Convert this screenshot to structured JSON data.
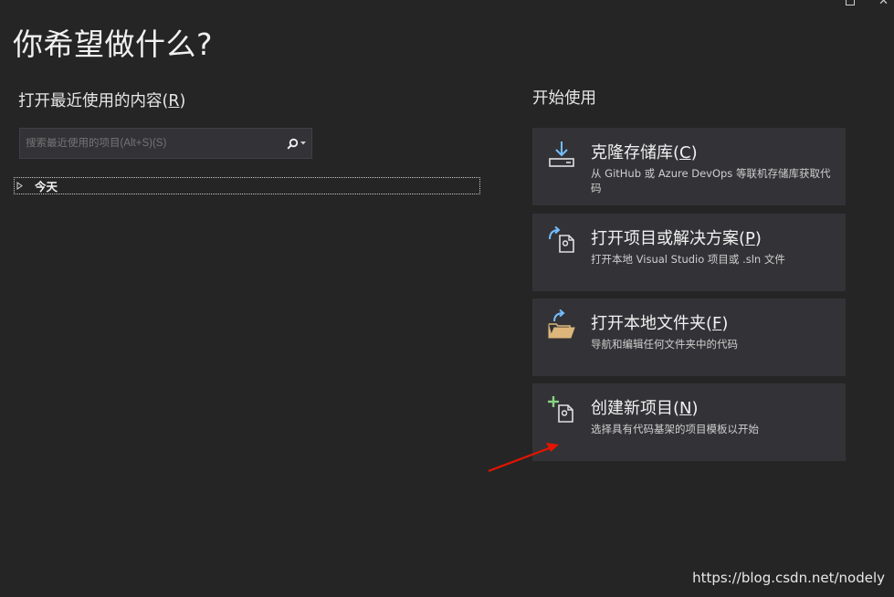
{
  "page": {
    "title": "你希望做什么?"
  },
  "recent": {
    "heading_text": "打开最近使用的内容(",
    "heading_key": "R",
    "heading_close": ")",
    "search_placeholder": "搜索最近使用的项目(Alt+S)(S)",
    "groups": [
      {
        "label": "今天"
      }
    ]
  },
  "get_started": {
    "heading": "开始使用",
    "cards": [
      {
        "title": "克隆存储库(",
        "key": "C",
        "close": ")",
        "description": "从 GitHub 或 Azure DevOps 等联机存储库获取代码",
        "icon": "clone-download-icon"
      },
      {
        "title": "打开项目或解决方案(",
        "key": "P",
        "close": ")",
        "description": "打开本地 Visual Studio 项目或 .sln 文件",
        "icon": "open-project-icon"
      },
      {
        "title": "打开本地文件夹(",
        "key": "F",
        "close": ")",
        "description": "导航和编辑任何文件夹中的代码",
        "icon": "open-folder-icon"
      },
      {
        "title": "创建新项目(",
        "key": "N",
        "close": ")",
        "description": "选择具有代码基架的项目模板以开始",
        "icon": "new-project-icon"
      }
    ]
  },
  "watermark": "https://blog.csdn.net/nodely",
  "colors": {
    "background": "#252526",
    "card": "#333337",
    "accent_blue": "#75beff",
    "accent_green": "#89d185",
    "folder_yellow": "#dcb67a",
    "annotation_red": "#e51400"
  }
}
